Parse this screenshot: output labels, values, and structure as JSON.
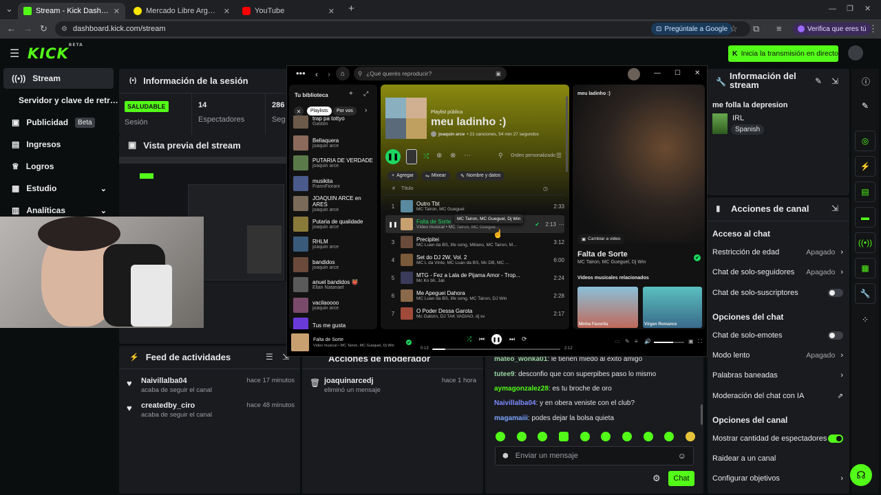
{
  "browser": {
    "tabs": [
      {
        "title": "Stream - Kick Dashboard"
      },
      {
        "title": "Mercado Libre Argentina - Envíos"
      },
      {
        "title": "YouTube"
      }
    ],
    "url": "dashboard.kick.com/stream",
    "ask_google": "Pregúntale a Google",
    "verify": "Verifica que eres tú"
  },
  "kick": {
    "logo": "KICK",
    "logo_sup": "BETA",
    "start_button": "Inicia la transmisión en directo",
    "nav": [
      {
        "label": "Stream",
        "icon": "stream-icon"
      },
      {
        "label": "Servidor y clave de retransmisión"
      },
      {
        "label": "Publicidad",
        "badge": "Beta",
        "icon": "publicity-icon"
      },
      {
        "label": "Ingresos",
        "icon": "income-icon"
      },
      {
        "label": "Logros",
        "icon": "trophy-icon"
      },
      {
        "label": "Estudio",
        "icon": "studio-icon"
      },
      {
        "label": "Analíticas",
        "icon": "analytics-icon"
      }
    ],
    "session": {
      "title": "Información de la sesión",
      "status": "SALUDABLE",
      "status_label": "Sesión",
      "viewers_value": "14",
      "viewers_label": "Espectadores",
      "followers_value": "286",
      "followers_label": "Seg"
    },
    "preview_title": "Vista previa del stream",
    "feed": {
      "title": "Feed de actividades",
      "items": [
        {
          "user": "Naivillalba04",
          "time": "hace 17 minutos",
          "action": "acaba de seguir el canal"
        },
        {
          "user": "createdby_ciro",
          "time": "hace 48 minutos",
          "action": "acaba de seguir el canal"
        }
      ]
    },
    "mod": {
      "title": "Acciones de moderador",
      "items": [
        {
          "user": "joaquinarcedj",
          "time": "hace 1 hora",
          "action": "eliminó un mensaje"
        }
      ]
    },
    "chat": {
      "messages": [
        {
          "user": "mateo_wonka01",
          "text": "le tienen miedo al exito amigo",
          "color": "#9ad3a0"
        },
        {
          "user": "tutee9",
          "text": "desconfio que con superpibes paso lo mismo",
          "color": "#9ad3a0"
        },
        {
          "user": "aymagonzalez28",
          "text": "es tu broche de oro",
          "color": "#53fc18"
        },
        {
          "user": "Naivillalba04",
          "text": "y en obera veniste con el club?",
          "color": "#7d8cff"
        },
        {
          "user": "magamaiii",
          "text": "podes dejar la bolsa quieta",
          "color": "#7da4ff"
        }
      ],
      "placeholder": "Enviar un mensaje",
      "send": "Chat"
    },
    "stream_info": {
      "title": "Información del stream",
      "stream_title": "me folla la depresion",
      "category": "IRL",
      "language": "Spanish"
    },
    "channel_actions": {
      "title": "Acciones de canal",
      "chat_section": "Acceso al chat",
      "age": "Restricción de edad",
      "age_val": "Apagado",
      "followers_only": "Chat de solo-seguidores",
      "followers_only_val": "Apagado",
      "subs_only": "Chat de solo-suscriptores",
      "chat_options": "Opciones del chat",
      "emotes_only": "Chat de solo-emotes",
      "slow_mode": "Modo lento",
      "slow_mode_val": "Apagado",
      "banned_words": "Palabras baneadas",
      "ai_mod": "Moderación del chat con IA",
      "channel_options": "Opciones del canal",
      "show_viewers": "Mostrar cantidad de espectadores",
      "raid": "Raidear a un canal",
      "goals": "Configurar objetivos"
    }
  },
  "spotify": {
    "search_placeholder": "¿Qué querés reproducir?",
    "library_title": "Tu biblioteca",
    "filters": [
      "Playlists",
      "Por vos"
    ],
    "library": [
      {
        "name": "trap pa tottyo",
        "owner": "Gaston",
        "color": "#6b5a4a"
      },
      {
        "name": "Bellaquera",
        "owner": "joaquin arce",
        "color": "#8a6a5a"
      },
      {
        "name": "PUTARIA DE VERDADE",
        "owner": "joaquin arce",
        "color": "#5a7a4a"
      },
      {
        "name": "musikita",
        "owner": "FrannFiorani",
        "color": "#4a5a8a"
      },
      {
        "name": "JOAQUIN ARCE en ARES",
        "owner": "joaquin arce",
        "color": "#7a6a5a"
      },
      {
        "name": "Putaria de qualidade",
        "owner": "joaquin arce",
        "color": "#8a7a3a"
      },
      {
        "name": "RHLM",
        "owner": "joaquin arce",
        "color": "#3a5a7a"
      },
      {
        "name": "bandidos",
        "owner": "joaquin arce",
        "color": "#6a4a3a"
      },
      {
        "name": "anuel bandidos 👹",
        "owner": "Elian Natanael",
        "color": "#5a5a5a"
      },
      {
        "name": "vacilaoooo",
        "owner": "joaquin arce",
        "color": "#7a4a6a"
      },
      {
        "name": "Tus me gusta",
        "owner": "",
        "color": "#6a3ad8"
      }
    ],
    "playlist": {
      "kind": "Playlist pública",
      "name": "meu ladinho :)",
      "owner": "joaquin arce",
      "meta": "• 21 canciones, 54 min 27 segundos"
    },
    "sort": "Orden personalizado",
    "actions": [
      "Agregar",
      "Mixear",
      "Nombre y datos"
    ],
    "col_title": "Título",
    "tracks": [
      {
        "n": "1",
        "title": "Outro Tbt",
        "artist": "MC Tairon, MC Gueguel",
        "dur": "2:33",
        "color": "#5a8aa0"
      },
      {
        "n": "2",
        "title": "Falta de Sorte",
        "artist": "Vídeo musical • MC Tairon, MC Guegue...",
        "dur": "2:13",
        "color": "#c8a070"
      },
      {
        "n": "3",
        "title": "Precipitei",
        "artist": "MC Luan da BS, life song, Miliano, MC Tairon, M...",
        "dur": "3:12",
        "color": "#6a4a3a"
      },
      {
        "n": "4",
        "title": "Set do DJ 2W, Vol. 2",
        "artist": "MC L da Vinte, MC Luan da BS, Mc DB, MC ...",
        "dur": "6:00",
        "color": "#7a5a3a"
      },
      {
        "n": "5",
        "title": "MTG - Fez a Lala de Pijama Amor - Trop...",
        "artist": "Mc Kn bh, Jali",
        "dur": "2:24",
        "color": "#3a3a5a"
      },
      {
        "n": "6",
        "title": "Me Apeguei Dahora",
        "artist": "MC Luan da BS, life song, MC Tairon, DJ Win",
        "dur": "2:28",
        "color": "#8a6a4a"
      },
      {
        "n": "7",
        "title": "O Poder Dessa Garota",
        "artist": "Mc Gabzin, DJ TAK VADIÃO, dj sv",
        "dur": "2:17",
        "color": "#a04a3a"
      }
    ],
    "tooltip": "MC Tairon, MC Gueguel, Dj Win",
    "np_panel_title": "meu ladinho :)",
    "switch_video": "Cambiar a video",
    "np_title": "Falta de Sorte",
    "np_artists": "MC Tairon, MC Gueguel, Dj Win",
    "related": "Videos musicales relacionados",
    "related_items": [
      "Minha Favorita",
      "Vírgen Romance"
    ],
    "bar": {
      "title": "Falta de Sorte",
      "artist": "Vídeo musical • MC Tairon, MC Gueguel, Dj Win",
      "elapsed": "0:13",
      "total": "2:12",
      "progress": 0.1
    }
  }
}
